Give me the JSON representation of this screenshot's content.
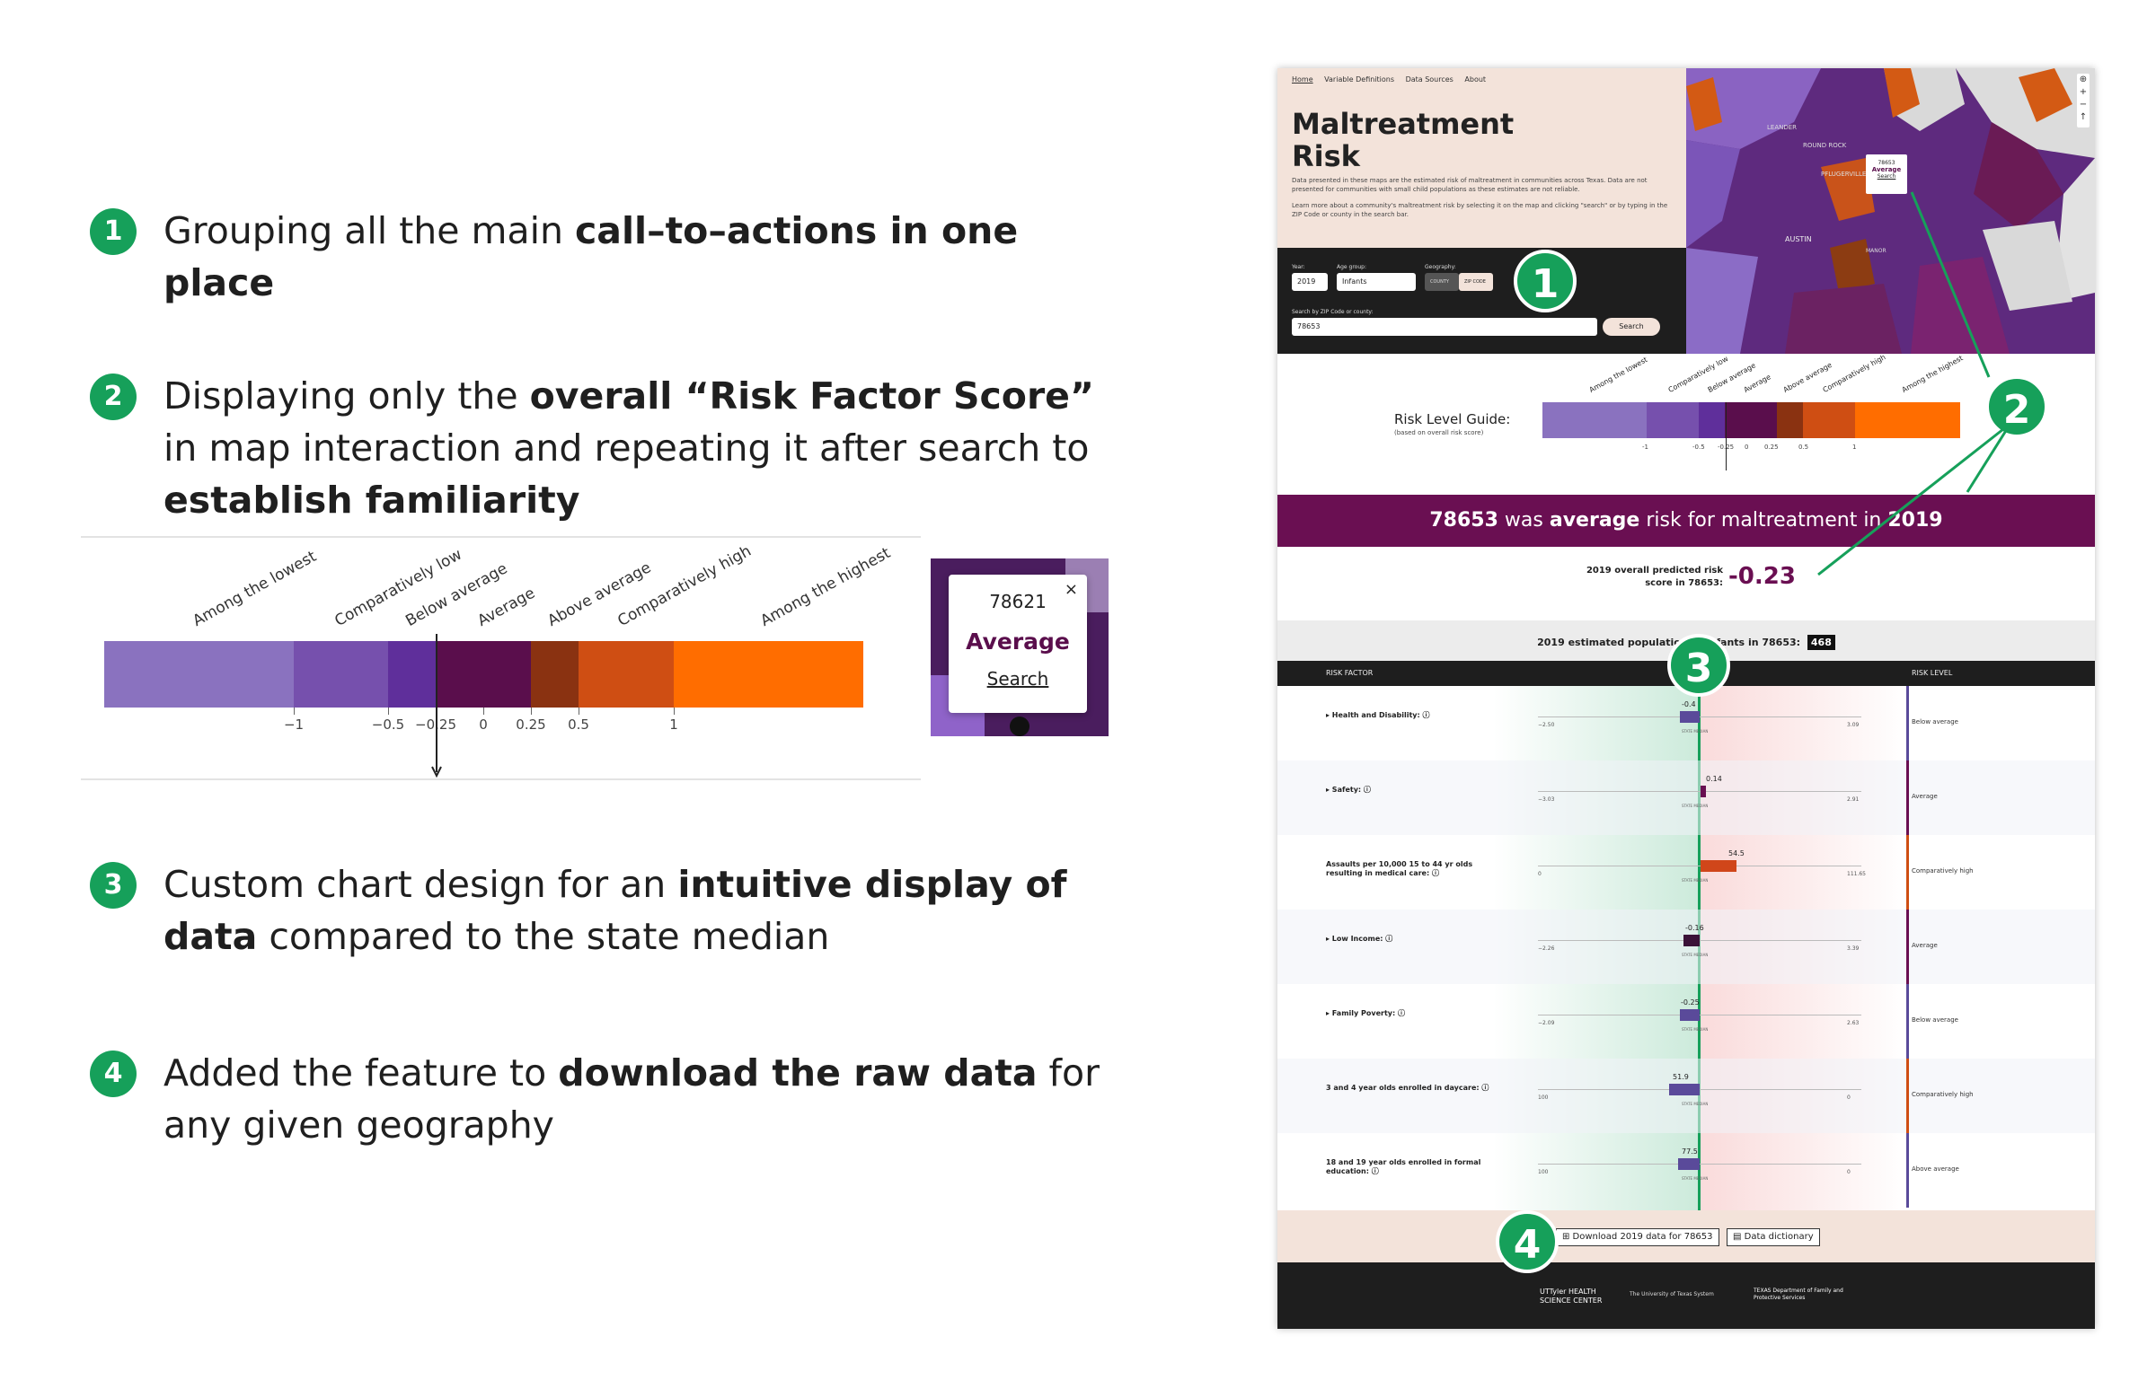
{
  "callouts": [
    {
      "num": "1",
      "pre": "Grouping all the main ",
      "bold": "call–to–actions in one place",
      "post": ""
    },
    {
      "num": "2",
      "pre": "Displaying only the ",
      "bold": "overall “Risk Factor Score”",
      "mid": " in map interaction and repeating it after search to ",
      "bold2": "establish familiarity"
    },
    {
      "num": "3",
      "pre": "Custom chart design for an ",
      "bold": "intuitive display of data",
      "post": " compared to the state median"
    },
    {
      "num": "4",
      "pre": "Added the feature to ",
      "bold": "download the raw data",
      "post": " for any given geography"
    }
  ],
  "risk_guide": {
    "categories": [
      "Among the lowest",
      "Comparatively low",
      "Below average",
      "Average",
      "Above average",
      "Comparatively high",
      "Among the highest"
    ],
    "ticks": [
      "−1",
      "−0.5",
      "−0.25",
      "0",
      "0.25",
      "0.5",
      "1"
    ],
    "colors": [
      "#8a72bf",
      "#7650ad",
      "#5f2f9b",
      "#5a0e4c",
      "#8a3211",
      "#cf4e13",
      "#ff6d00"
    ],
    "marker_value": "-0.23"
  },
  "popup": {
    "zip": "78621",
    "close": "×",
    "level": "Average",
    "search": "Search"
  },
  "site": {
    "nav": [
      "Home",
      "Variable Definitions",
      "Data Sources",
      "About"
    ],
    "title_line1": "Maltreatment",
    "title_line2": "Risk",
    "intro1": "Data presented in these maps are the estimated risk of maltreatment in communities across Texas. Data are not presented for communities with small child populations as these estimates are not reliable.",
    "intro2": "Learn more about a community's maltreatment risk by selecting it on the map and clicking \"search\" or by typing in the ZIP Code or county in the search bar.",
    "year_label": "Year:",
    "year_value": "2019",
    "age_label": "Age group:",
    "age_value": "Infants",
    "geo_label": "Geography:",
    "geo_county": "COUNTY",
    "geo_zip": "ZIP CODE",
    "search_label": "Search by ZIP Code or county:",
    "search_value": "78653",
    "search_button": "Search",
    "map_popup": {
      "zip": "78653",
      "level": "Average",
      "search": "Search"
    },
    "map_labels": [
      "LEANDER",
      "ROUND ROCK",
      "PFLUGERVILLE",
      "AUSTIN",
      "MANOR"
    ],
    "guide_title": "Risk Level Guide:",
    "guide_sub": "(based on overall risk score)",
    "small_ticks": [
      "-1",
      "-0.5",
      "-0.25",
      "0",
      "0.25",
      "0.5",
      "1"
    ],
    "banner_zip": "78653",
    "banner_mid1": " was ",
    "banner_level": "average",
    "banner_mid2": " risk for maltreatment in ",
    "banner_year": "2019",
    "score_label": "2019 overall predicted risk score in 78653:",
    "score_value": "-0.23",
    "pop_text": "2019 estimated population of infants in 78653:",
    "pop_value": "468",
    "col_factor": "RISK FACTOR",
    "col_level": "RISK LEVEL",
    "median_label": "STATE MEDIAN",
    "rows": [
      {
        "label": "▸ Health and Disability: ⓘ",
        "value": "-0.4",
        "min": "−2.50",
        "max": "3.09",
        "level": "Below average",
        "color": "#5a4a9a",
        "bar": "#5a4a9a"
      },
      {
        "label": "▸ Safety: ⓘ",
        "value": "0.14",
        "min": "−3.03",
        "max": "2.91",
        "level": "Average",
        "color": "#6a0f52",
        "bar": "#6a0f52"
      },
      {
        "label": "Assaults per 10,000 15 to 44 yr olds resulting in medical care: ⓘ",
        "value": "54.5",
        "min": "0",
        "max": "111.65",
        "level": "Comparatively high",
        "color": "#cf4e13",
        "bar": "#d0461a"
      },
      {
        "label": "▸ Low Income: ⓘ",
        "value": "-0.16",
        "min": "−2.26",
        "max": "3.39",
        "level": "Average",
        "color": "#6a0f52",
        "bar": "#3b1238"
      },
      {
        "label": "▸ Family Poverty: ⓘ",
        "value": "-0.25",
        "min": "−2.09",
        "max": "2.63",
        "level": "Below average",
        "color": "#5a4a9a",
        "bar": "#5a4a9a"
      },
      {
        "label": "3 and 4 year olds enrolled in daycare: ⓘ",
        "value": "51.9",
        "min": "100",
        "max": "0",
        "level": "Comparatively high",
        "color": "#cf4e13",
        "bar": "#5a4a9a"
      },
      {
        "label": "18 and 19 year olds enrolled in formal education: ⓘ",
        "value": "77.5",
        "min": "100",
        "max": "0",
        "level": "Above average",
        "color": "#5a4a9a",
        "bar": "#5a4a9a"
      }
    ],
    "download_button": "⊞ Download 2019 data for 78653",
    "dictionary_button": "▤ Data dictionary",
    "logos": [
      "UTTyler HEALTH SCIENCE CENTER",
      "The University of Texas System",
      "TEXAS Department of Family and Protective Services"
    ]
  },
  "badges": [
    "1",
    "2",
    "3",
    "4"
  ]
}
